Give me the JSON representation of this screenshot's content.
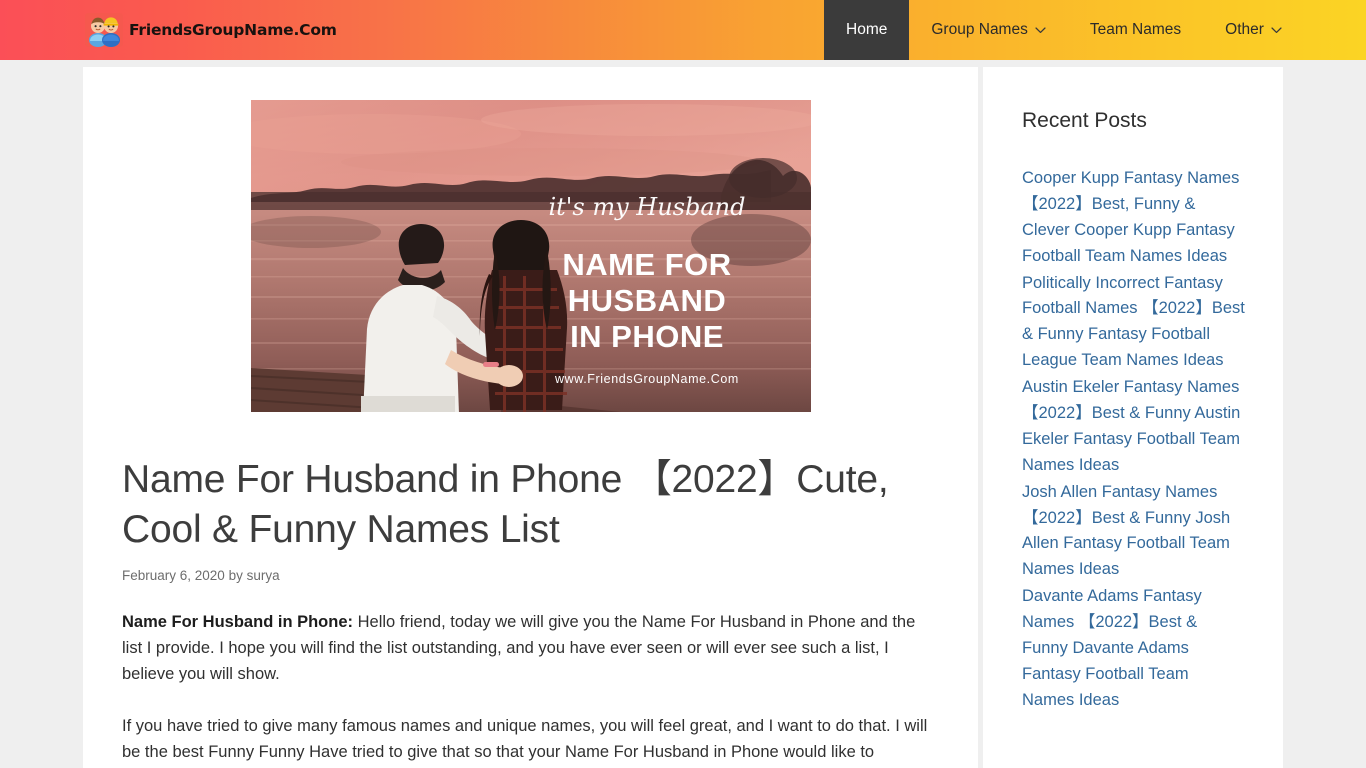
{
  "header": {
    "brand": {
      "name": "FriendsGroupName.Com",
      "logo_icon": "two-kids-icon"
    },
    "gradient": {
      "from": "#fb4f57",
      "mid": "#f9a232",
      "to": "#fbd424"
    },
    "nav": [
      {
        "label": "Home",
        "current": true,
        "has_dropdown": false
      },
      {
        "label": "Group Names",
        "current": false,
        "has_dropdown": true
      },
      {
        "label": "Team Names",
        "current": false,
        "has_dropdown": false
      },
      {
        "label": "Other",
        "current": false,
        "has_dropdown": true
      }
    ]
  },
  "article": {
    "featured_image": {
      "alt": "Couple sitting by a lake at sunset",
      "overlay_script": "it's my Husband",
      "overlay_line1": "NAME FOR",
      "overlay_line2": "HUSBAND",
      "overlay_line3": "IN PHONE",
      "overlay_url": "www.FriendsGroupName.Com"
    },
    "title": "Name For Husband in Phone 【2022】Cute, Cool & Funny Names List",
    "date": "February 6, 2020",
    "by_label": "by",
    "author": "surya",
    "paragraphs": [
      {
        "lead": "Name For Husband in Phone:",
        "text": " Hello friend, today we will give you the Name For Husband in Phone and the list I provide. I hope you will find the list outstanding, and you have ever seen or will ever see such a list, I believe you will show."
      },
      {
        "lead": "",
        "text": "If you have tried to give many famous names and unique names, you will feel great, and I want to do that. I will be the best Funny Funny Have tried to give that so that your Name For Husband in Phone would like to"
      }
    ]
  },
  "sidebar": {
    "widget_title": "Recent Posts",
    "link_color": "#33699b",
    "recent_posts": [
      "Cooper Kupp Fantasy Names 【2022】Best, Funny & Clever Cooper Kupp Fantasy Football Team Names Ideas",
      "Politically Incorrect Fantasy Football Names 【2022】Best & Funny Fantasy Football League Team Names Ideas",
      "Austin Ekeler Fantasy Names 【2022】Best & Funny Austin Ekeler Fantasy Football Team Names Ideas",
      "Josh Allen Fantasy Names 【2022】Best & Funny Josh Allen Fantasy Football Team Names Ideas",
      "Davante Adams Fantasy Names 【2022】Best & Funny Davante Adams Fantasy Football Team Names Ideas"
    ]
  }
}
